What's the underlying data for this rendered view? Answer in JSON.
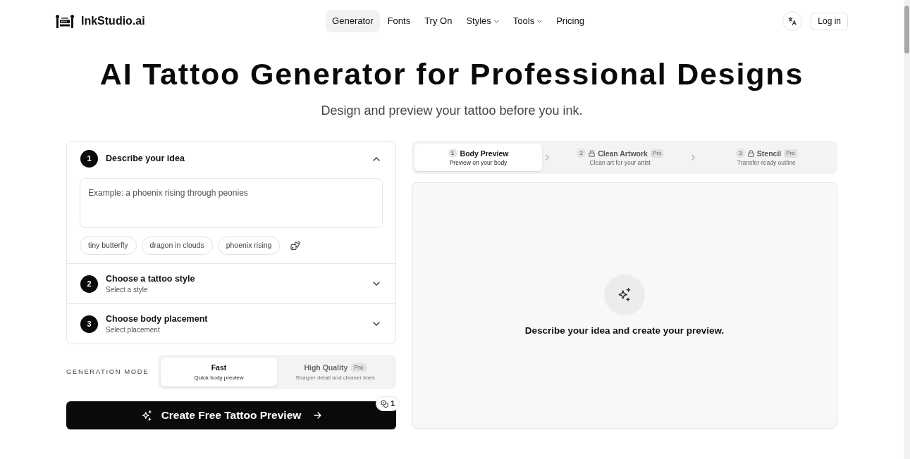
{
  "nav": {
    "brand": "InkStudio.ai",
    "links": [
      {
        "label": "Generator",
        "selected": true,
        "dropdown": false
      },
      {
        "label": "Fonts",
        "selected": false,
        "dropdown": false
      },
      {
        "label": "Try On",
        "selected": false,
        "dropdown": false
      },
      {
        "label": "Styles",
        "selected": false,
        "dropdown": true
      },
      {
        "label": "Tools",
        "selected": false,
        "dropdown": true
      },
      {
        "label": "Pricing",
        "selected": false,
        "dropdown": false
      }
    ],
    "login": "Log in"
  },
  "hero": {
    "title": "AI Tattoo Generator for Professional Designs",
    "subtitle": "Design and preview your tattoo before you ink."
  },
  "steps": [
    {
      "number": "1",
      "title": "Describe your idea",
      "expanded": true,
      "prompt": {
        "placeholder": "Example: a phoenix rising through peonies"
      },
      "suggestions": [
        "tiny butterfly",
        "dragon in clouds",
        "phoenix rising"
      ]
    },
    {
      "number": "2",
      "title": "Choose a tattoo style",
      "subtitle": "Select a style",
      "expanded": false
    },
    {
      "number": "3",
      "title": "Choose body placement",
      "subtitle": "Select placement",
      "expanded": false
    }
  ],
  "generation_mode": {
    "label": "GENERATION MODE",
    "options": [
      {
        "title": "Fast",
        "subtitle": "Quick body preview",
        "selected": true
      },
      {
        "title": "High Quality",
        "badge": "Pro",
        "subtitle": "Sharper detail and cleaner lines",
        "selected": false
      }
    ]
  },
  "create_button": {
    "label": "Create Free Tattoo Preview",
    "credits": "1"
  },
  "output_tabs": [
    {
      "number": "1",
      "title": "Body Preview",
      "subtitle": "Preview on your body",
      "locked": false,
      "selected": true
    },
    {
      "number": "2",
      "title": "Clean Artwork",
      "badge": "Pro",
      "subtitle": "Clean art for your artist",
      "locked": true,
      "selected": false
    },
    {
      "number": "3",
      "title": "Stencil",
      "badge": "Pro",
      "subtitle": "Transfer-ready outline",
      "locked": true,
      "selected": false
    }
  ],
  "preview": {
    "message": "Describe your idea and create your preview."
  }
}
